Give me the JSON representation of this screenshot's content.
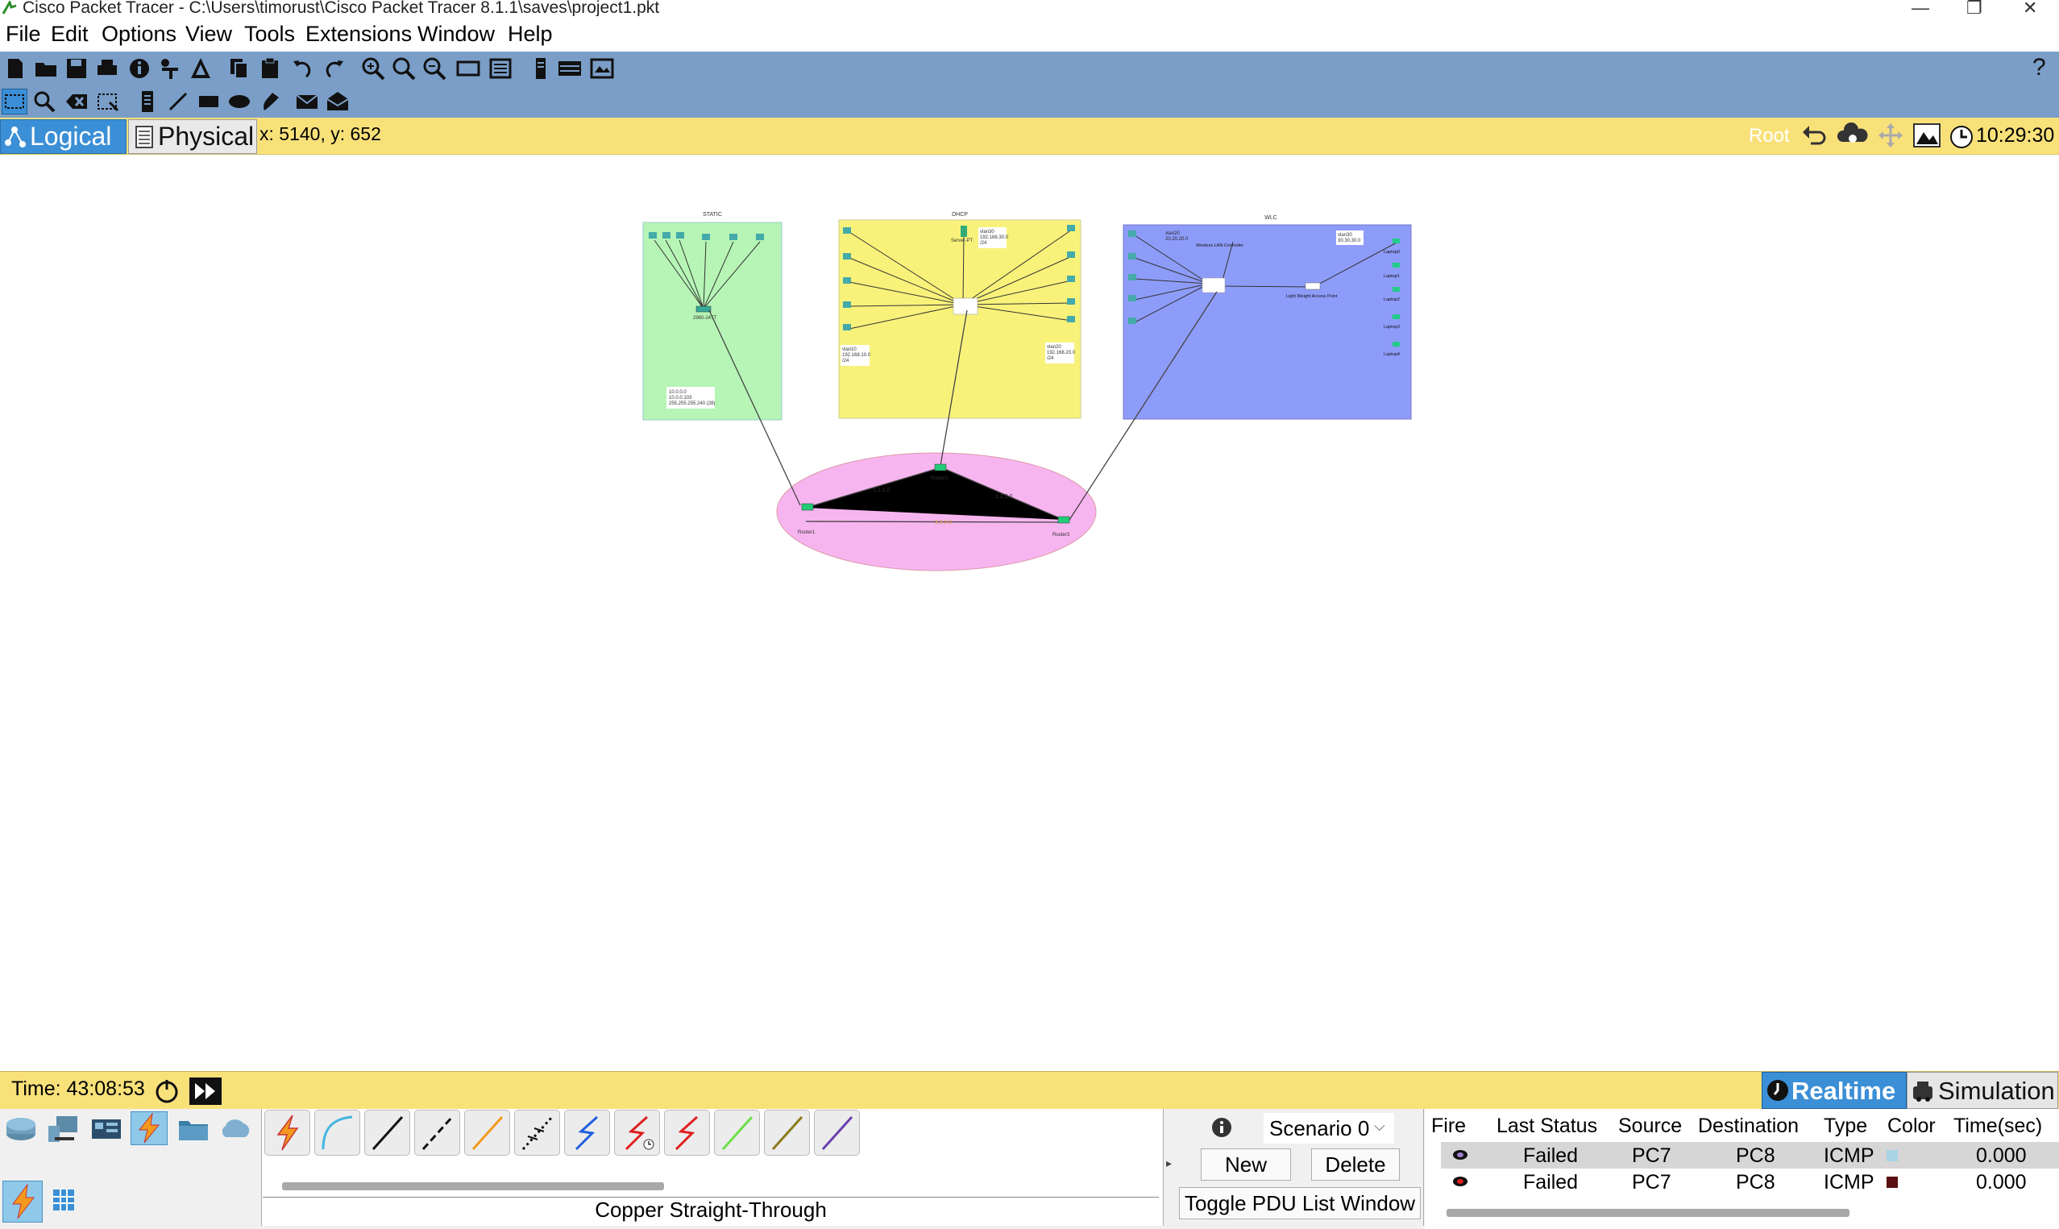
{
  "window": {
    "title": "Cisco Packet Tracer - C:\\Users\\timorust\\Cisco Packet Tracer 8.1.1\\saves\\project1.pkt",
    "minimize": "—",
    "restore": "❐",
    "close": "✕"
  },
  "menu": [
    "File",
    "Edit",
    "Options",
    "View",
    "Tools",
    "Extensions",
    "Window",
    "Help"
  ],
  "toolbar": {
    "help_label": "?"
  },
  "modebar": {
    "logical_label": "Logical",
    "physical_label": "Physical",
    "coords": "x: 5140, y: 652",
    "root_label": "Root",
    "clock": "10:29:30"
  },
  "topology": {
    "areas": [
      {
        "title": "STATIC",
        "color": "#b6f5b6"
      },
      {
        "title": "DHCP",
        "color": "#f8f27a"
      },
      {
        "title": "WLC",
        "color": "#8e9cf9"
      }
    ],
    "static_note": [
      "10.0.0.0",
      "10.0.0.103",
      "255.255.255.240 (28)"
    ],
    "static_switch": "2960-24TT",
    "dhcp_server": "Server-PT",
    "dhcp_vlan30": [
      "vlan30",
      "192.168.30.0",
      "/24"
    ],
    "dhcp_vlan10": [
      "vlan10",
      "192.168.10.0",
      "/24"
    ],
    "dhcp_vlan20": [
      "vlan20",
      "192.168.20.0",
      "/24"
    ],
    "wlc_vlan20": [
      "vlan20",
      "20.20.20.0"
    ],
    "wlc_vlan30": [
      "vlan30",
      "30.30.30.0"
    ],
    "wlc_ap": "Light Weight Access Point",
    "wlc_controller": "Wireless LAN Controller",
    "laptops": [
      "Laptop0",
      "Laptop1",
      "Laptop2",
      "Laptop3",
      "Laptop4"
    ],
    "core_links": [
      "1.1.1.0",
      "2.2.2.0",
      "3.3.3.0"
    ],
    "routers": [
      "Router1",
      "Router2",
      "Router3"
    ]
  },
  "time": {
    "label": "Time: 43:08:53"
  },
  "mode_buttons": {
    "realtime": "Realtime",
    "simulation": "Simulation"
  },
  "cables": {
    "selected_name": "Copper Straight-Through",
    "items": [
      {
        "name": "automatic",
        "color": "#f0a020"
      },
      {
        "name": "console",
        "color": "#44b5e0"
      },
      {
        "name": "copper-straight",
        "color": "#000000"
      },
      {
        "name": "copper-cross",
        "color": "#000000"
      },
      {
        "name": "fiber",
        "color": "#f39a1e"
      },
      {
        "name": "phone",
        "color": "#000000"
      },
      {
        "name": "coaxial",
        "color": "#1f5fe0"
      },
      {
        "name": "serial-dce",
        "color": "#e01f1f"
      },
      {
        "name": "serial-dte",
        "color": "#e01f1f"
      },
      {
        "name": "octal",
        "color": "#6be04a"
      },
      {
        "name": "iot",
        "color": "#8a7a1a"
      },
      {
        "name": "usb",
        "color": "#6a3fb0"
      }
    ]
  },
  "scenario": {
    "selected": "Scenario 0",
    "new_label": "New",
    "delete_label": "Delete",
    "toggle_label": "Toggle PDU List Window"
  },
  "pdu_table": {
    "headers": [
      "Fire",
      "Last Status",
      "Source",
      "Destination",
      "Type",
      "Color",
      "Time(sec)"
    ],
    "rows": [
      {
        "status": "Failed",
        "source": "PC7",
        "destination": "PC8",
        "type": "ICMP",
        "color": "#a8d4e6",
        "time": "0.000"
      },
      {
        "status": "Failed",
        "source": "PC7",
        "destination": "PC8",
        "type": "ICMP",
        "color": "#5a1010",
        "time": "0.000"
      }
    ]
  }
}
